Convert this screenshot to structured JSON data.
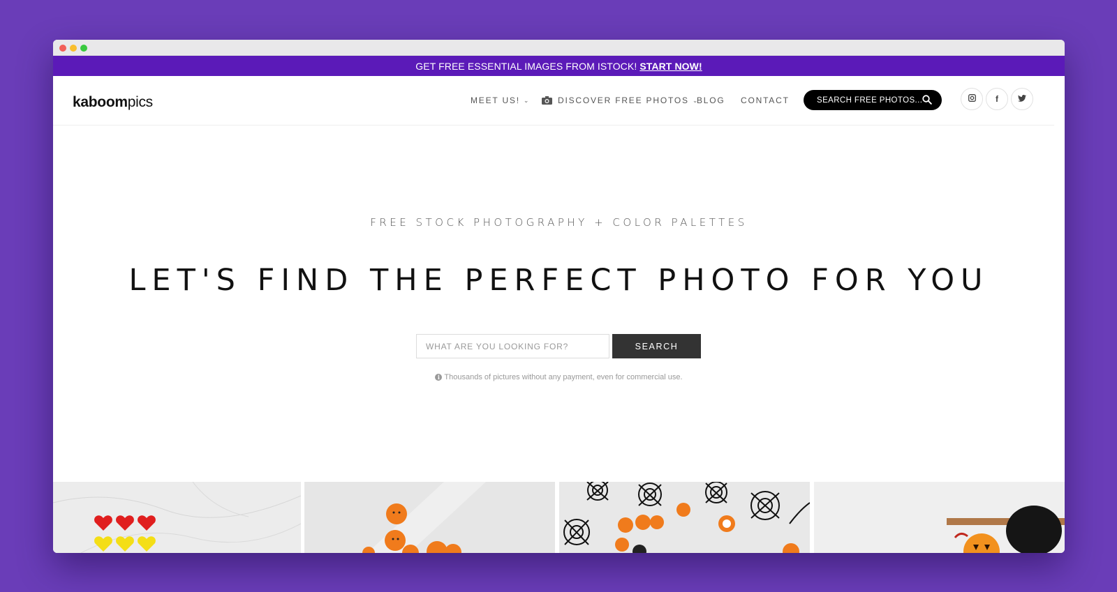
{
  "promo": {
    "text": "GET FREE ESSENTIAL IMAGES FROM ISTOCK!",
    "link": "START NOW!"
  },
  "logo": {
    "bold": "kaboom",
    "light": "pics"
  },
  "nav": {
    "meet": "MEET US!",
    "discover": "DISCOVER FREE PHOTOS",
    "blog": "BLOG",
    "contact": "CONTACT",
    "search_label": "SEARCH FREE PHOTOS..."
  },
  "social": {
    "instagram": "instagram-icon",
    "facebook": "f",
    "twitter": "twitter-icon"
  },
  "hero": {
    "tagline": "FREE STOCK PHOTOGRAPHY + COLOR PALETTES",
    "headline": "LET'S FIND THE PERFECT PHOTO FOR YOU",
    "search_placeholder": "WHAT ARE YOU LOOKING FOR?",
    "search_button": "SEARCH",
    "note": "Thousands of pictures without any payment, even for commercial use."
  },
  "colors": {
    "page_bg": "#6a3db8",
    "promo_bg": "#5b1ab8",
    "search_btn": "#333333"
  }
}
